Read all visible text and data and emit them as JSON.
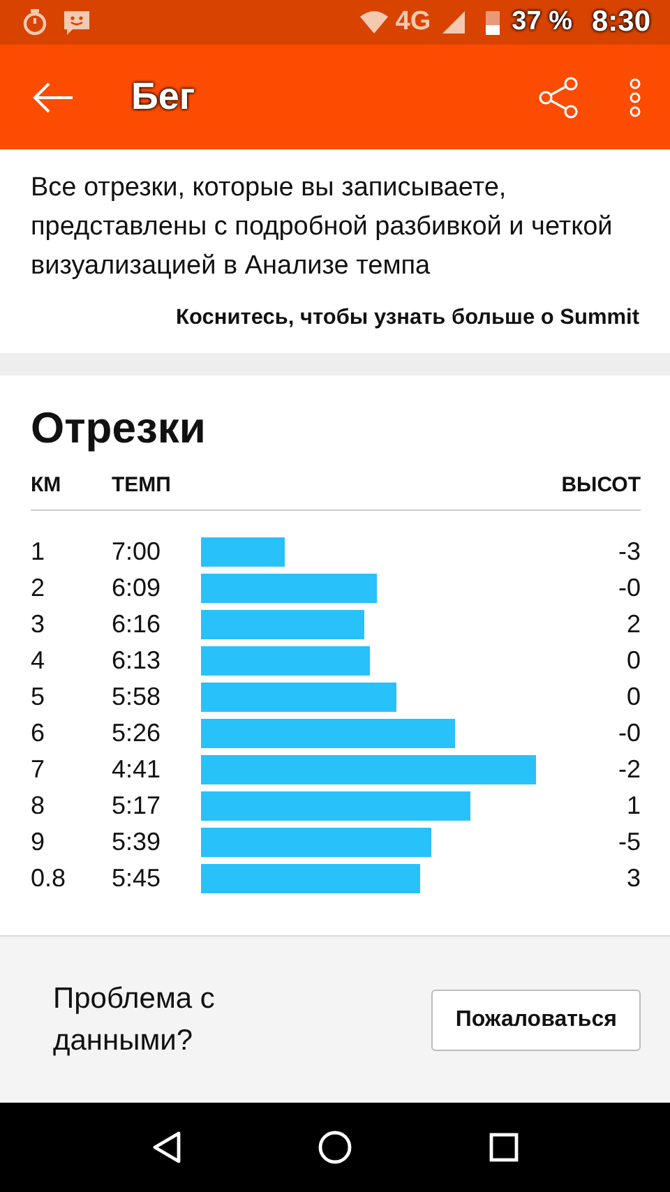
{
  "status_bar": {
    "battery": "37 %",
    "network": "4G",
    "time": "8:30"
  },
  "app_bar": {
    "title": "Бег"
  },
  "intro": {
    "text": "Все отрезки, которые вы записываете, представлены с подробной разбивкой и четкой визуализацией в Анализе темпа",
    "link": "Коснитесь, чтобы узнать больше о Summit"
  },
  "splits": {
    "title": "Отрезки",
    "columns": [
      "КМ",
      "ТЕМП",
      "ВЫСОТ"
    ],
    "rows": [
      {
        "km": "1",
        "pace": "7:00",
        "elevation": "-3"
      },
      {
        "km": "2",
        "pace": "6:09",
        "elevation": "-0"
      },
      {
        "km": "3",
        "pace": "6:16",
        "elevation": "2"
      },
      {
        "km": "4",
        "pace": "6:13",
        "elevation": "0"
      },
      {
        "km": "5",
        "pace": "5:58",
        "elevation": "0"
      },
      {
        "km": "6",
        "pace": "5:26",
        "elevation": "-0"
      },
      {
        "km": "7",
        "pace": "4:41",
        "elevation": "-2"
      },
      {
        "km": "8",
        "pace": "5:17",
        "elevation": "1"
      },
      {
        "km": "9",
        "pace": "5:39",
        "elevation": "-5"
      },
      {
        "km": "0.8",
        "pace": "5:45",
        "elevation": "3"
      }
    ]
  },
  "feedback": {
    "question": "Проблема с данными?",
    "button": "Пожаловаться"
  }
}
